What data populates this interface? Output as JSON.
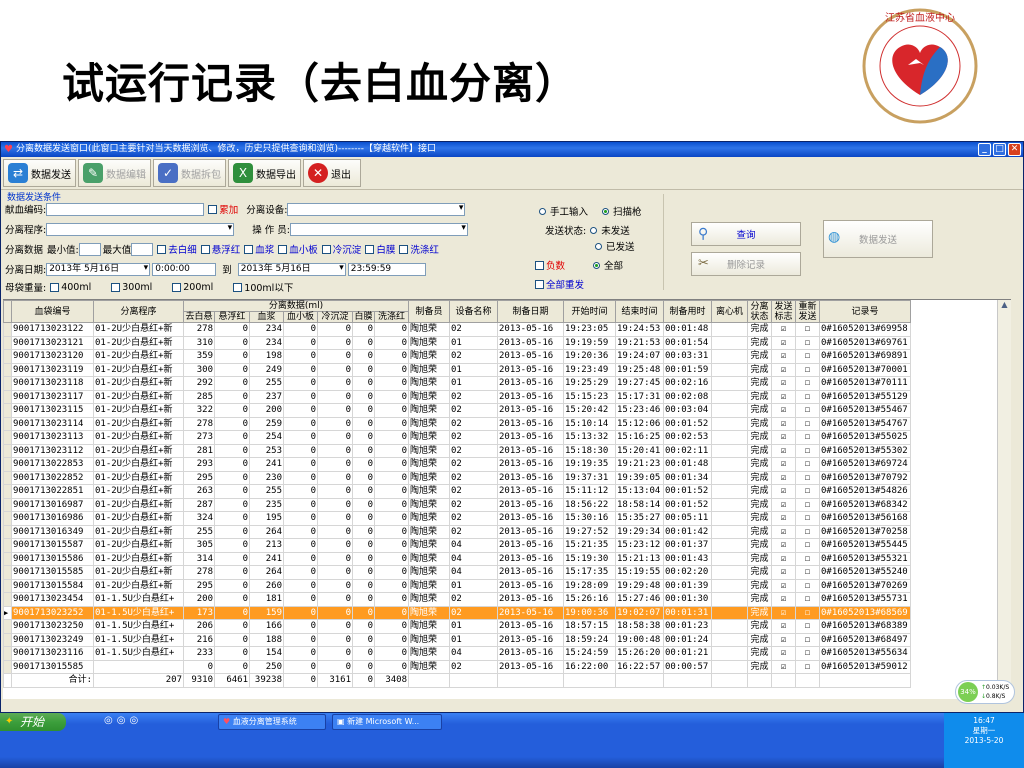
{
  "slide": {
    "title": "试运行记录（去白血分离）"
  },
  "window": {
    "title": "分离数据发送窗口(此窗口主要针对当天数据浏览、修改，历史只提供查询和浏览)--------【穿越软件】接口",
    "controls": [
      "_",
      "□",
      "✕"
    ]
  },
  "toolbar": [
    {
      "label": "数据发送",
      "icon": "send-icon",
      "color": "#2a7fd4",
      "enabled": true
    },
    {
      "label": "数据编辑",
      "icon": "edit-icon",
      "color": "#4aa06a",
      "enabled": false
    },
    {
      "label": "数据拆包",
      "icon": "unpack-icon",
      "color": "#4a6fc4",
      "enabled": false
    },
    {
      "label": "数据导出",
      "icon": "excel-icon",
      "color": "#2f8f3c",
      "enabled": true
    },
    {
      "label": "退出",
      "icon": "exit-icon",
      "color": "#d42020",
      "enabled": true
    }
  ],
  "filters": {
    "group_label": "数据发送条件",
    "donor_code_label": "献血编码:",
    "donor_code_value": "",
    "accumulate_label": "累加",
    "device_label": "分离设备:",
    "device_value": "",
    "program_label": "分离程序:",
    "program_value": "",
    "operator_label": "操 作 员:",
    "operator_value": "",
    "data_label": "分离数据",
    "min_label": "最小值:",
    "max_label": "最大值",
    "components": [
      "去白细",
      "悬浮红",
      "血浆",
      "血小板",
      "冷沉淀",
      "白膜",
      "洗涤红"
    ],
    "date_label": "分离日期:",
    "date_from": "2013年 5月16日",
    "time_from": "0:00:00",
    "to_label": "到",
    "date_to": "2013年 5月16日",
    "time_to": "23:59:59",
    "weight_label": "母袋重量:",
    "weights": [
      "400ml",
      "300ml",
      "200ml",
      "100ml以下"
    ],
    "input_modes": [
      "手工输入",
      "扫描枪"
    ],
    "input_mode_selected": "扫描枪",
    "send_status_label": "发送状态:",
    "send_status_options": [
      "未发送",
      "已发送",
      "全部"
    ],
    "send_status_selected": "全部",
    "negative_label": "负数",
    "resend_all_label": "全部重发",
    "query_button": "查询",
    "delete_button": "删除记录",
    "send_button": "数据发送"
  },
  "grid": {
    "headers_top": [
      "血袋编号",
      "分离程序",
      "分离数据(ml)",
      "制备员",
      "设备名称",
      "制备日期",
      "开始时间",
      "结束时间",
      "制备用时",
      "离心机",
      "分离状态",
      "发送标志",
      "重新发送",
      "记录号"
    ],
    "sub_headers": [
      "去白悬",
      "悬浮红",
      "血浆",
      "血小板",
      "冷沉淀",
      "白膜",
      "洗涤红"
    ],
    "rows": [
      [
        "9001713023122",
        "01-2U少白悬红+新",
        "278",
        "0",
        "234",
        "0",
        "0",
        "0",
        "0",
        "陶旭荣",
        "02",
        "2013-05-16",
        "19:23:05",
        "19:24:53",
        "00:01:48",
        "",
        "完成",
        "☑",
        "☐",
        "0#16052013#69958"
      ],
      [
        "9001713023121",
        "01-2U少白悬红+新",
        "310",
        "0",
        "234",
        "0",
        "0",
        "0",
        "0",
        "陶旭荣",
        "01",
        "2013-05-16",
        "19:19:59",
        "19:21:53",
        "00:01:54",
        "",
        "完成",
        "☑",
        "☐",
        "0#16052013#69761"
      ],
      [
        "9001713023120",
        "01-2U少白悬红+新",
        "359",
        "0",
        "198",
        "0",
        "0",
        "0",
        "0",
        "陶旭荣",
        "02",
        "2013-05-16",
        "19:20:36",
        "19:24:07",
        "00:03:31",
        "",
        "完成",
        "☑",
        "☐",
        "0#16052013#69891"
      ],
      [
        "9001713023119",
        "01-2U少白悬红+新",
        "300",
        "0",
        "249",
        "0",
        "0",
        "0",
        "0",
        "陶旭荣",
        "01",
        "2013-05-16",
        "19:23:49",
        "19:25:48",
        "00:01:59",
        "",
        "完成",
        "☑",
        "☐",
        "0#16052013#70001"
      ],
      [
        "9001713023118",
        "01-2U少白悬红+新",
        "292",
        "0",
        "255",
        "0",
        "0",
        "0",
        "0",
        "陶旭荣",
        "01",
        "2013-05-16",
        "19:25:29",
        "19:27:45",
        "00:02:16",
        "",
        "完成",
        "☑",
        "☐",
        "0#16052013#70111"
      ],
      [
        "9001713023117",
        "01-2U少白悬红+新",
        "285",
        "0",
        "237",
        "0",
        "0",
        "0",
        "0",
        "陶旭荣",
        "02",
        "2013-05-16",
        "15:15:23",
        "15:17:31",
        "00:02:08",
        "",
        "完成",
        "☑",
        "☐",
        "0#16052013#55129"
      ],
      [
        "9001713023115",
        "01-2U少白悬红+新",
        "322",
        "0",
        "200",
        "0",
        "0",
        "0",
        "0",
        "陶旭荣",
        "02",
        "2013-05-16",
        "15:20:42",
        "15:23:46",
        "00:03:04",
        "",
        "完成",
        "☑",
        "☐",
        "0#16052013#55467"
      ],
      [
        "9001713023114",
        "01-2U少白悬红+新",
        "278",
        "0",
        "259",
        "0",
        "0",
        "0",
        "0",
        "陶旭荣",
        "02",
        "2013-05-16",
        "15:10:14",
        "15:12:06",
        "00:01:52",
        "",
        "完成",
        "☑",
        "☐",
        "0#16052013#54767"
      ],
      [
        "9001713023113",
        "01-2U少白悬红+新",
        "273",
        "0",
        "254",
        "0",
        "0",
        "0",
        "0",
        "陶旭荣",
        "02",
        "2013-05-16",
        "15:13:32",
        "15:16:25",
        "00:02:53",
        "",
        "完成",
        "☑",
        "☐",
        "0#16052013#55025"
      ],
      [
        "9001713023112",
        "01-2U少白悬红+新",
        "281",
        "0",
        "253",
        "0",
        "0",
        "0",
        "0",
        "陶旭荣",
        "02",
        "2013-05-16",
        "15:18:30",
        "15:20:41",
        "00:02:11",
        "",
        "完成",
        "☑",
        "☐",
        "0#16052013#55302"
      ],
      [
        "9001713022853",
        "01-2U少白悬红+新",
        "293",
        "0",
        "241",
        "0",
        "0",
        "0",
        "0",
        "陶旭荣",
        "02",
        "2013-05-16",
        "19:19:35",
        "19:21:23",
        "00:01:48",
        "",
        "完成",
        "☑",
        "☐",
        "0#16052013#69724"
      ],
      [
        "9001713022852",
        "01-2U少白悬红+新",
        "295",
        "0",
        "230",
        "0",
        "0",
        "0",
        "0",
        "陶旭荣",
        "02",
        "2013-05-16",
        "19:37:31",
        "19:39:05",
        "00:01:34",
        "",
        "完成",
        "☑",
        "☐",
        "0#16052013#70792"
      ],
      [
        "9001713022851",
        "01-2U少白悬红+新",
        "263",
        "0",
        "255",
        "0",
        "0",
        "0",
        "0",
        "陶旭荣",
        "02",
        "2013-05-16",
        "15:11:12",
        "15:13:04",
        "00:01:52",
        "",
        "完成",
        "☑",
        "☐",
        "0#16052013#54826"
      ],
      [
        "9001713016987",
        "01-2U少白悬红+新",
        "287",
        "0",
        "235",
        "0",
        "0",
        "0",
        "0",
        "陶旭荣",
        "02",
        "2013-05-16",
        "18:56:22",
        "18:58:14",
        "00:01:52",
        "",
        "完成",
        "☑",
        "☐",
        "0#16052013#68342"
      ],
      [
        "9001713016986",
        "01-2U少白悬红+新",
        "324",
        "0",
        "195",
        "0",
        "0",
        "0",
        "0",
        "陶旭荣",
        "02",
        "2013-05-16",
        "15:30:16",
        "15:35:27",
        "00:05:11",
        "",
        "完成",
        "☑",
        "☐",
        "0#16052013#56168"
      ],
      [
        "9001713016349",
        "01-2U少白悬红+新",
        "255",
        "0",
        "264",
        "0",
        "0",
        "0",
        "0",
        "陶旭荣",
        "02",
        "2013-05-16",
        "19:27:52",
        "19:29:34",
        "00:01:42",
        "",
        "完成",
        "☑",
        "☐",
        "0#16052013#70258"
      ],
      [
        "9001713015587",
        "01-2U少白悬红+新",
        "305",
        "0",
        "213",
        "0",
        "0",
        "0",
        "0",
        "陶旭荣",
        "04",
        "2013-05-16",
        "15:21:35",
        "15:23:12",
        "00:01:37",
        "",
        "完成",
        "☑",
        "☐",
        "0#16052013#55445"
      ],
      [
        "9001713015586",
        "01-2U少白悬红+新",
        "314",
        "0",
        "241",
        "0",
        "0",
        "0",
        "0",
        "陶旭荣",
        "04",
        "2013-05-16",
        "15:19:30",
        "15:21:13",
        "00:01:43",
        "",
        "完成",
        "☑",
        "☐",
        "0#16052013#55321"
      ],
      [
        "9001713015585",
        "01-2U少白悬红+新",
        "278",
        "0",
        "264",
        "0",
        "0",
        "0",
        "0",
        "陶旭荣",
        "04",
        "2013-05-16",
        "15:17:35",
        "15:19:55",
        "00:02:20",
        "",
        "完成",
        "☑",
        "☐",
        "0#16052013#55240"
      ],
      [
        "9001713015584",
        "01-2U少白悬红+新",
        "295",
        "0",
        "260",
        "0",
        "0",
        "0",
        "0",
        "陶旭荣",
        "01",
        "2013-05-16",
        "19:28:09",
        "19:29:48",
        "00:01:39",
        "",
        "完成",
        "☑",
        "☐",
        "0#16052013#70269"
      ],
      [
        "9001713023454",
        "01-1.5U少白悬红+",
        "200",
        "0",
        "181",
        "0",
        "0",
        "0",
        "0",
        "陶旭荣",
        "02",
        "2013-05-16",
        "15:26:16",
        "15:27:46",
        "00:01:30",
        "",
        "完成",
        "☑",
        "☐",
        "0#16052013#55731"
      ],
      [
        "9001713023252",
        "01-1.5U少白悬红+",
        "173",
        "0",
        "159",
        "0",
        "0",
        "0",
        "0",
        "陶旭荣",
        "02",
        "2013-05-16",
        "19:00:36",
        "19:02:07",
        "00:01:31",
        "",
        "完成",
        "☑",
        "☐",
        "0#16052013#68569"
      ],
      [
        "9001713023250",
        "01-1.5U少白悬红+",
        "206",
        "0",
        "166",
        "0",
        "0",
        "0",
        "0",
        "陶旭荣",
        "01",
        "2013-05-16",
        "18:57:15",
        "18:58:38",
        "00:01:23",
        "",
        "完成",
        "☑",
        "☐",
        "0#16052013#68389"
      ],
      [
        "9001713023249",
        "01-1.5U少白悬红+",
        "216",
        "0",
        "188",
        "0",
        "0",
        "0",
        "0",
        "陶旭荣",
        "01",
        "2013-05-16",
        "18:59:24",
        "19:00:48",
        "00:01:24",
        "",
        "完成",
        "☑",
        "☐",
        "0#16052013#68497"
      ],
      [
        "9001713023116",
        "01-1.5U少白悬红+",
        "233",
        "0",
        "154",
        "0",
        "0",
        "0",
        "0",
        "陶旭荣",
        "04",
        "2013-05-16",
        "15:24:59",
        "15:26:20",
        "00:01:21",
        "",
        "完成",
        "☑",
        "☐",
        "0#16052013#55634"
      ],
      [
        "9001713015585",
        "",
        "0",
        "0",
        "250",
        "0",
        "0",
        "0",
        "0",
        "陶旭荣",
        "02",
        "2013-05-16",
        "16:22:00",
        "16:22:57",
        "00:00:57",
        "",
        "完成",
        "☑",
        "☐",
        "0#16052013#59012"
      ]
    ],
    "selected_row": 21,
    "totals_label": "合计:",
    "totals": [
      "207",
      "9310",
      "6461",
      "39238",
      "0",
      "3161",
      "0",
      "3408"
    ]
  },
  "taskbar": {
    "start_label": "开始",
    "tasks": [
      "血液分离管理系统",
      "新建 Microsoft W..."
    ],
    "clock_time": "16:47",
    "clock_day": "星期一",
    "clock_date": "2013-5-20"
  },
  "net_widget": {
    "percent": "34%",
    "up": "0.03K/S",
    "down": "0.8K/S"
  }
}
